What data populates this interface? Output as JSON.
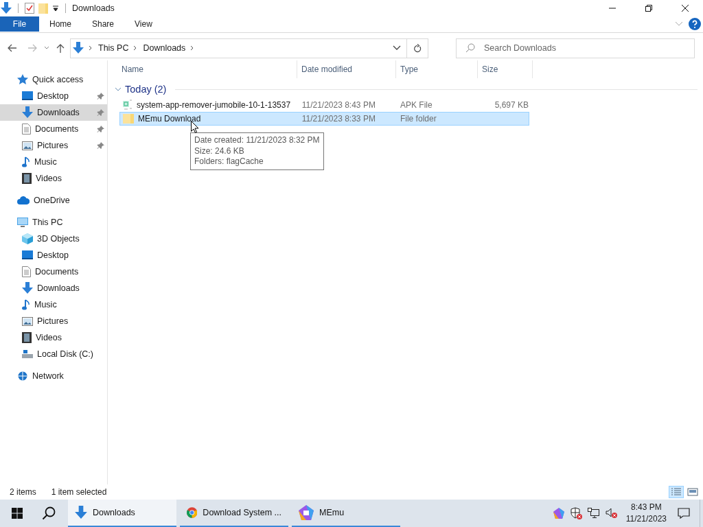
{
  "window": {
    "title": "Downloads"
  },
  "ribbon": {
    "tabs": [
      {
        "label": "File",
        "kind": "file",
        "selected": false
      },
      {
        "label": "Home",
        "kind": "tab",
        "selected": false
      },
      {
        "label": "Share",
        "kind": "tab",
        "selected": false
      },
      {
        "label": "View",
        "kind": "tab",
        "selected": false
      }
    ]
  },
  "address": {
    "breadcrumb": [
      "This PC",
      "Downloads"
    ],
    "search": {
      "placeholder": "Search Downloads"
    }
  },
  "sidebar": {
    "items": [
      {
        "label": "Quick access",
        "kind": "star",
        "selected": false,
        "children": [
          {
            "label": "Desktop",
            "kind": "desktop",
            "pinned": true,
            "selected": false
          },
          {
            "label": "Downloads",
            "kind": "download",
            "pinned": true,
            "selected": true
          },
          {
            "label": "Documents",
            "kind": "document",
            "pinned": true,
            "selected": false
          },
          {
            "label": "Pictures",
            "kind": "pictures",
            "pinned": true,
            "selected": false
          },
          {
            "label": "Music",
            "kind": "music",
            "pinned": false,
            "selected": false
          },
          {
            "label": "Videos",
            "kind": "videos",
            "pinned": false,
            "selected": false
          }
        ]
      },
      {
        "label": "OneDrive",
        "kind": "cloud",
        "selected": false
      },
      {
        "label": "This PC",
        "kind": "pc",
        "selected": false,
        "children": [
          {
            "label": "3D Objects",
            "kind": "cube",
            "pinned": false,
            "selected": false
          },
          {
            "label": "Desktop",
            "kind": "desktop",
            "pinned": false,
            "selected": false
          },
          {
            "label": "Documents",
            "kind": "document",
            "pinned": false,
            "selected": false
          },
          {
            "label": "Downloads",
            "kind": "download",
            "pinned": false,
            "selected": false
          },
          {
            "label": "Music",
            "kind": "music",
            "pinned": false,
            "selected": false
          },
          {
            "label": "Pictures",
            "kind": "pictures",
            "pinned": false,
            "selected": false
          },
          {
            "label": "Videos",
            "kind": "videos",
            "pinned": false,
            "selected": false
          },
          {
            "label": "Local Disk (C:)",
            "kind": "disk",
            "pinned": false,
            "selected": false
          }
        ]
      },
      {
        "label": "Network",
        "kind": "network",
        "selected": false
      }
    ]
  },
  "table": {
    "columns": [
      "Name",
      "Date modified",
      "Type",
      "Size"
    ],
    "groups": [
      {
        "label": "Today (2)",
        "expanded": true,
        "rows": [
          {
            "name": "system-app-remover-jumobile-10-1-13537",
            "date_modified": "11/21/2023 8:43 PM",
            "type": "APK File",
            "size": "5,697 KB",
            "kind": "apk",
            "selected": false
          },
          {
            "name": "MEmu Download",
            "date_modified": "11/21/2023 8:33 PM",
            "type": "File folder",
            "size": "",
            "kind": "folder",
            "selected": true
          }
        ]
      }
    ]
  },
  "tooltip": {
    "lines": [
      "Date created: 11/21/2023 8:32 PM",
      "Size: 24.6 KB",
      "Folders: flagCache"
    ]
  },
  "status_bar": {
    "item_count": "2 items",
    "selection": "1 item selected",
    "views": [
      {
        "kind": "details",
        "selected": true
      },
      {
        "kind": "large",
        "selected": false
      }
    ]
  },
  "taskbar": {
    "apps": [
      {
        "label": "Downloads",
        "kind": "explorer",
        "selected": true
      },
      {
        "label": "Download System ...",
        "kind": "chrome",
        "selected": false
      },
      {
        "label": "MEmu",
        "kind": "memu",
        "selected": false
      }
    ],
    "clock": {
      "time": "8:43 PM",
      "date": "11/21/2023"
    }
  }
}
